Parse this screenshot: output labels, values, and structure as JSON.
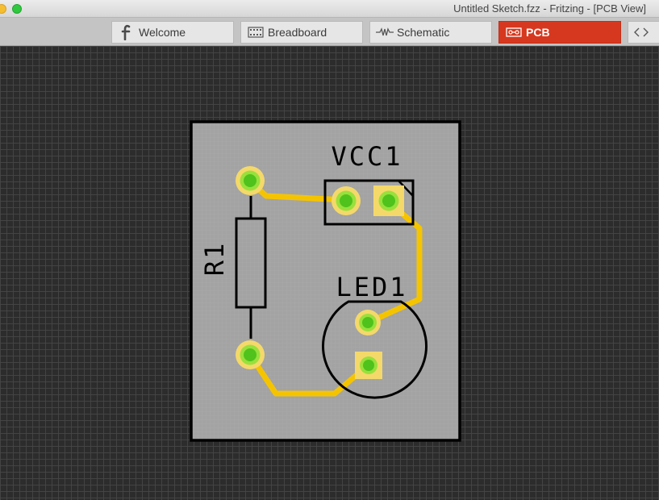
{
  "window": {
    "title": "Untitled Sketch.fzz - Fritzing - [PCB View]"
  },
  "tabs": [
    {
      "label": "Welcome",
      "icon": "fritzing-f-icon",
      "active": false
    },
    {
      "label": "Breadboard",
      "icon": "breadboard-icon",
      "active": false
    },
    {
      "label": "Schematic",
      "icon": "schematic-resistor-icon",
      "active": false
    },
    {
      "label": "PCB",
      "icon": "pcb-icon",
      "active": true
    },
    {
      "label": "",
      "icon": "code-icon",
      "active": false
    }
  ],
  "pcb": {
    "labels": {
      "vcc": "VCC1",
      "led": "LED1",
      "resistor": "R1"
    }
  },
  "colors": {
    "active_tab": "#d6381f",
    "board_fill": "#a3a3a3",
    "board_outline": "#000000",
    "trace": "#f5c400",
    "pad_ring": "#f4d96a",
    "pad_center": "#55cc22",
    "canvas_bg": "#2c2c2c"
  }
}
